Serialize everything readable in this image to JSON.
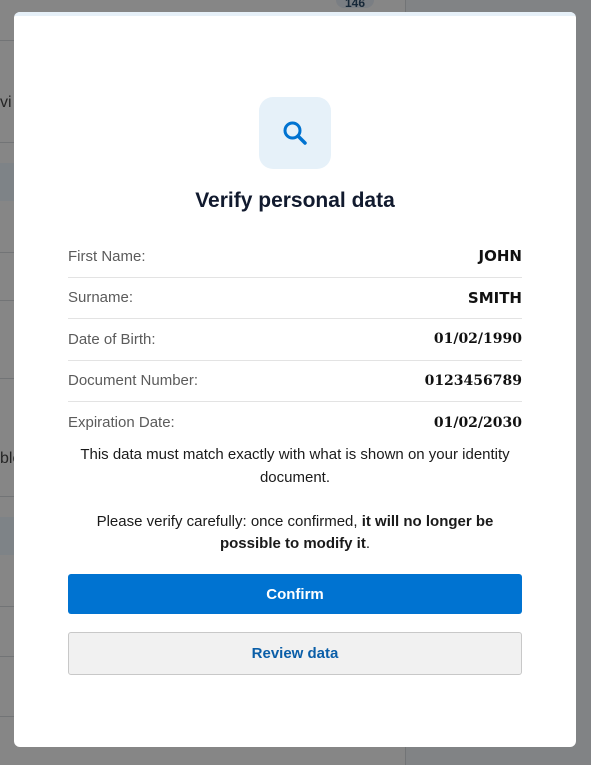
{
  "background": {
    "fragments": [
      "vi",
      "ble"
    ],
    "badge": "146"
  },
  "modal": {
    "icon": "search-icon",
    "title": "Verify personal data",
    "fields": [
      {
        "label": "First Name:",
        "value": "JOHN"
      },
      {
        "label": "Surname:",
        "value": "SMITH"
      },
      {
        "label": "Date of Birth:",
        "value": "01/02/1990"
      },
      {
        "label": "Document Number:",
        "value": "0123456789"
      },
      {
        "label": "Expiration Date:",
        "value": "01/02/2030"
      }
    ],
    "note": "This data must match exactly with what is shown on your identity document.",
    "warning_prefix": "Please verify carefully: once confirmed, ",
    "warning_bold": "it will no longer be possible to modify it",
    "warning_suffix": ".",
    "confirm_label": "Confirm",
    "review_label": "Review data"
  },
  "colors": {
    "primary": "#0073d1",
    "icon_bg": "#e6f1f9",
    "title": "#111a2e"
  }
}
